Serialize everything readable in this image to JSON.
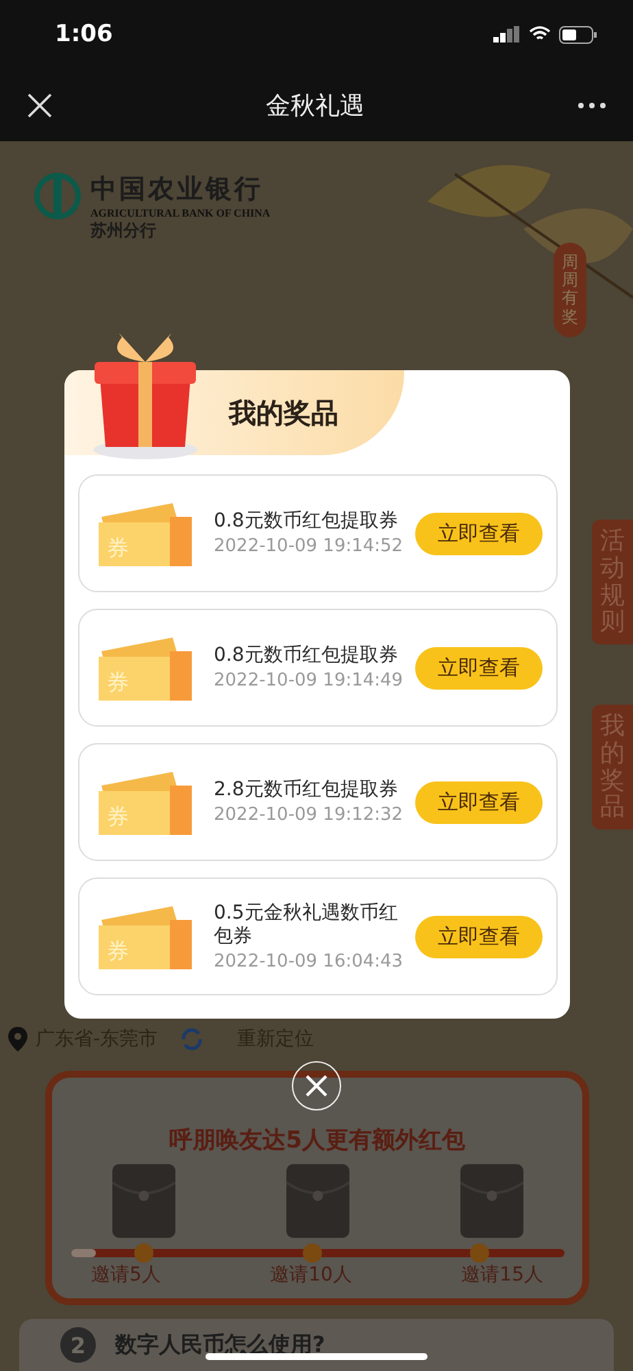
{
  "status_bar": {
    "time": "1:06"
  },
  "nav": {
    "title": "金秋礼遇"
  },
  "bank": {
    "name_cn": "中国农业银行",
    "name_en": "AGRICULTURAL BANK OF CHINA",
    "branch": "苏州分行"
  },
  "side_tag": "周周有奖",
  "side_tabs": [
    "活动规则",
    "我的奖品"
  ],
  "location": {
    "place": "广东省-东莞市",
    "action": "重新定位"
  },
  "invite": {
    "title": "呼朋唤友达5人更有额外红包",
    "level": 0.05,
    "milestones": [
      "邀请5人",
      "邀请10人",
      "邀请15人"
    ]
  },
  "faq": {
    "number": "2",
    "question": "数字人民币怎么使用?"
  },
  "dialog": {
    "title": "我的奖品",
    "items": [
      {
        "ticket_label": "券",
        "name": "0.8元数币红包提取券",
        "time": "2022-10-09 19:14:52",
        "button": "立即查看"
      },
      {
        "ticket_label": "券",
        "name": "0.8元数币红包提取券",
        "time": "2022-10-09 19:14:49",
        "button": "立即查看"
      },
      {
        "ticket_label": "券",
        "name": "2.8元数币红包提取券",
        "time": "2022-10-09 19:12:32",
        "button": "立即查看"
      },
      {
        "ticket_label": "券",
        "name": "0.5元金秋礼遇数币红包券",
        "time": "2022-10-09 16:04:43",
        "button": "立即查看"
      }
    ]
  }
}
